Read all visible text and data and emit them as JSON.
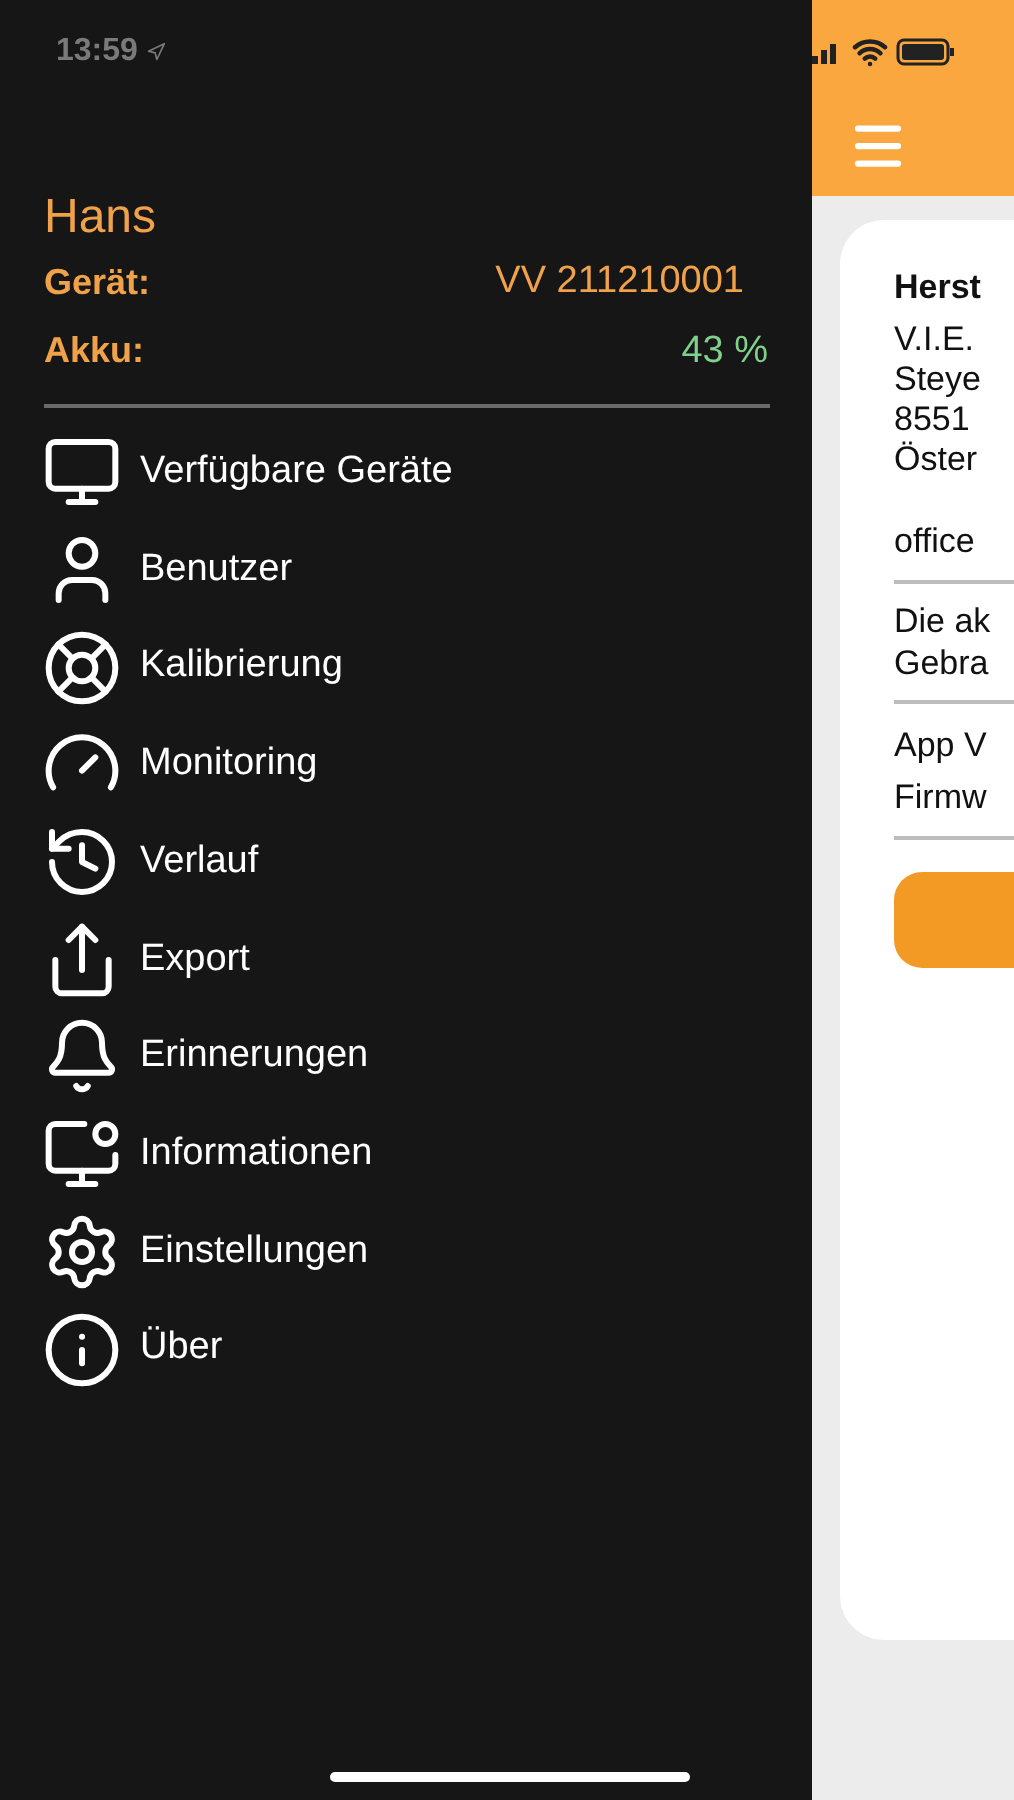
{
  "status_bar": {
    "time": "13:59"
  },
  "drawer": {
    "user": "Hans",
    "device_label": "Gerät:",
    "device_value": "VV 211210001",
    "battery_label": "Akku:",
    "battery_value": "43 %",
    "items": [
      {
        "label": "Verfügbare Geräte"
      },
      {
        "label": "Benutzer"
      },
      {
        "label": "Kalibrierung"
      },
      {
        "label": "Monitoring"
      },
      {
        "label": "Verlauf"
      },
      {
        "label": "Export"
      },
      {
        "label": "Erinnerungen"
      },
      {
        "label": "Informationen"
      },
      {
        "label": "Einstellungen"
      },
      {
        "label": "Über"
      }
    ]
  },
  "card": {
    "heading": "Herst",
    "address": [
      "V.I.E.",
      "Steye",
      "8551",
      "Öster"
    ],
    "email": "office",
    "notice": [
      "Die ak",
      "Gebra"
    ],
    "versions": [
      "App V",
      "Firmw"
    ]
  }
}
